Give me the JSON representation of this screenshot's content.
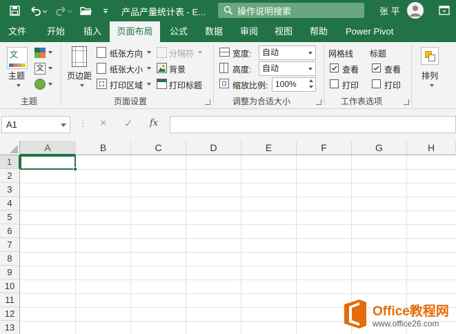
{
  "titlebar": {
    "title": "产品产量统计表 - E...",
    "tellme_placeholder": "操作说明搜索",
    "user": "张 平",
    "save_icon": "save-icon",
    "undo_icon": "undo-icon",
    "redo_icon": "redo-icon",
    "open_icon": "open-folder-icon",
    "customize_icon": "customize-qat-icon",
    "accent": "#217346"
  },
  "tabs": [
    {
      "label": "文件"
    },
    {
      "label": "开始"
    },
    {
      "label": "插入"
    },
    {
      "label": "页面布局"
    },
    {
      "label": "公式"
    },
    {
      "label": "数据"
    },
    {
      "label": "审阅"
    },
    {
      "label": "视图"
    },
    {
      "label": "帮助"
    },
    {
      "label": "Power Pivot"
    }
  ],
  "active_tab": "页面布局",
  "ribbon": {
    "themes": {
      "themes_btn": "主题",
      "icon_text": "文",
      "group_label": "主题"
    },
    "page_setup": {
      "margins": "页边距",
      "orientation": "纸张方向",
      "size": "纸张大小",
      "print_area": "打印区域",
      "breaks": "分隔符",
      "background": "背景",
      "print_titles": "打印标题",
      "group_label": "页面设置"
    },
    "scale": {
      "width_label": "宽度:",
      "width_value": "自动",
      "height_label": "高度:",
      "height_value": "自动",
      "scale_label": "缩放比例:",
      "scale_value": "100%",
      "group_label": "调整为合适大小"
    },
    "sheet_options": {
      "gridlines": "网格线",
      "headings": "标题",
      "view": "查看",
      "print": "打印",
      "gridlines_view_checked": true,
      "gridlines_print_checked": false,
      "headings_view_checked": true,
      "headings_print_checked": false,
      "group_label": "工作表选项"
    },
    "arrange": {
      "label": "排列"
    }
  },
  "formula_bar": {
    "name_box": "A1",
    "cancel_icon": "×",
    "enter_icon": "✓",
    "fx": "fx",
    "formula": ""
  },
  "grid": {
    "columns": [
      "A",
      "B",
      "C",
      "D",
      "E",
      "F",
      "G",
      "H"
    ],
    "rows": [
      "1",
      "2",
      "3",
      "4",
      "5",
      "6",
      "7",
      "8",
      "9",
      "10",
      "11",
      "12",
      "13"
    ],
    "active_cell": "A1"
  },
  "watermark": {
    "line1": "Office教程网",
    "line2": "www.office26.com"
  }
}
